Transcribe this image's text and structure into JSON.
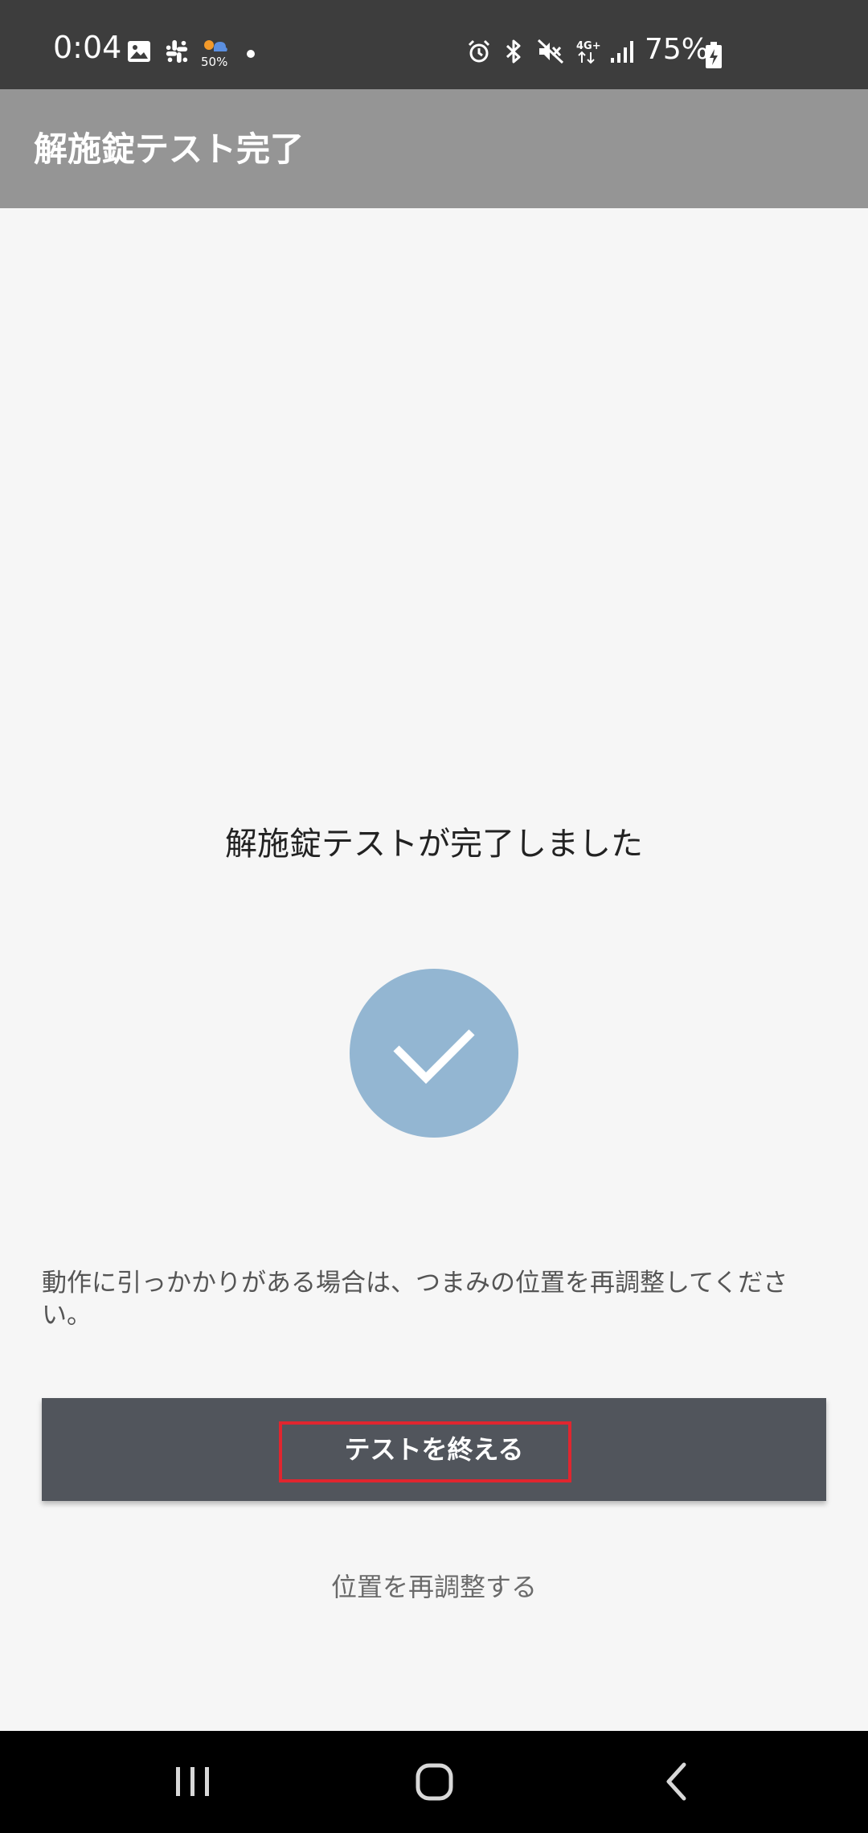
{
  "status_bar": {
    "time": "0:04",
    "weather_percent": "50%",
    "battery_percent": "75%",
    "icons": [
      "image-icon",
      "slack-icon",
      "weather-icon",
      "alarm-icon",
      "bluetooth-icon",
      "mute-icon",
      "4g-data-icon",
      "signal-icon",
      "battery-charging-icon"
    ]
  },
  "app_bar": {
    "title": "解施錠テスト完了"
  },
  "main": {
    "heading": "解施錠テストが完了しました",
    "success_icon": "check-icon",
    "success_color": "#93b6d2",
    "hint": "動作に引っかかりがある場合は、つまみの位置を再調整してください。",
    "primary_button_label": "テストを終える",
    "primary_button_color": "#51555c",
    "highlight_color": "#e0262f",
    "secondary_link_label": "位置を再調整する"
  },
  "nav_bar": {
    "buttons": [
      "recent-apps-icon",
      "home-icon",
      "back-icon"
    ]
  }
}
